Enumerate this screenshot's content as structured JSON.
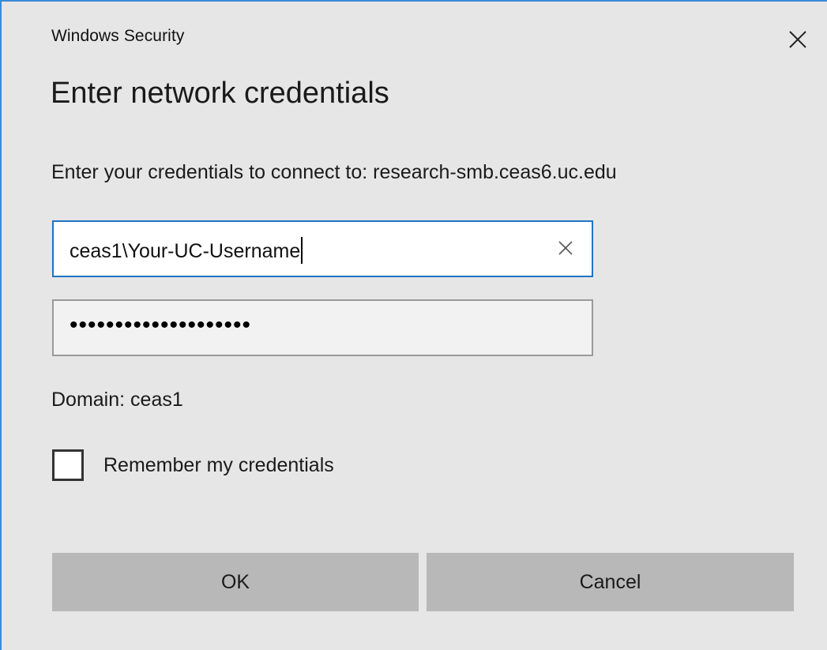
{
  "window": {
    "title": "Windows Security",
    "close_icon": "close-icon"
  },
  "heading": "Enter network credentials",
  "message": "Enter your credentials to connect to: research-smb.ceas6.uc.edu",
  "username": {
    "value": "ceas1\\Your-UC-Username",
    "clear_icon": "clear-icon"
  },
  "password": {
    "masked_value": "••••••••••••••••••••"
  },
  "domain_text": "Domain: ceas1",
  "remember": {
    "label": "Remember my credentials",
    "checked": false
  },
  "buttons": {
    "ok": "OK",
    "cancel": "Cancel"
  },
  "colors": {
    "dialog_bg": "#e6e6e6",
    "accent_border": "#1f73c4",
    "button_bg": "#b8b8b8"
  }
}
